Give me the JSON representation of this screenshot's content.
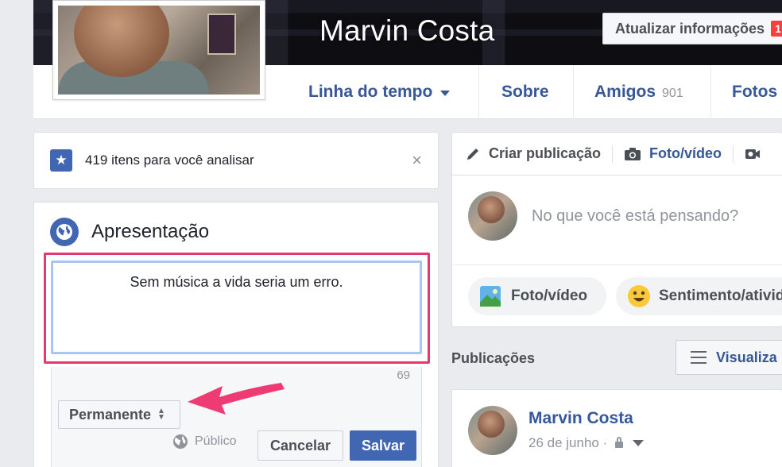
{
  "profile": {
    "name": "Marvin Costa",
    "update_info_label": "Atualizar informações",
    "update_badge": "1"
  },
  "nav": {
    "timeline": "Linha do tempo",
    "about": "Sobre",
    "friends": "Amigos",
    "friends_count": "901",
    "photos": "Fotos"
  },
  "review": {
    "text": "419 itens para você analisar",
    "close": "×"
  },
  "intro": {
    "title": "Apresentação",
    "bio_value": "Sem música a vida seria um erro.",
    "char_remaining": "69",
    "duration": "Permanente",
    "audience": "Público",
    "cancel": "Cancelar",
    "save": "Salvar"
  },
  "composer": {
    "create_post": "Criar publicação",
    "photo_video_tab": "Foto/vídeo",
    "placeholder": "No que você está pensando?",
    "photo_video_pill": "Foto/vídeo",
    "feeling_pill": "Sentimento/ativid"
  },
  "posts": {
    "title": "Publicações",
    "view_button": "Visualiza",
    "author": "Marvin Costa",
    "date": "26 de junho ·"
  },
  "colors": {
    "brand": "#4267b2",
    "link": "#365899",
    "highlight": "#e8376e",
    "badge": "#fa3e3e"
  }
}
